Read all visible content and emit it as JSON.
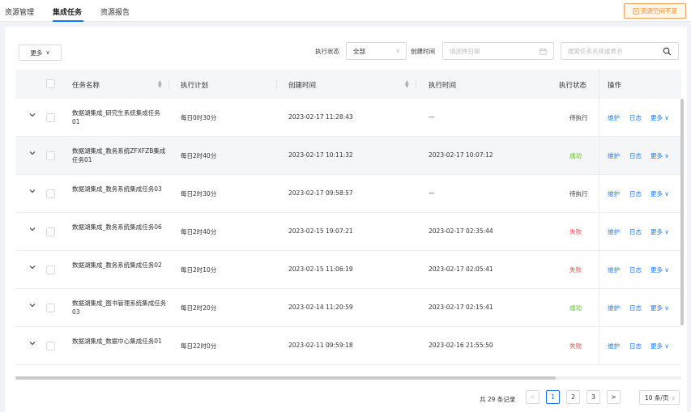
{
  "tabs": [
    {
      "label": "资源管理",
      "active": false
    },
    {
      "label": "集成任务",
      "active": true
    },
    {
      "label": "资源报告",
      "active": false
    }
  ],
  "warning_button": {
    "label": "资源空间不足",
    "icon": "edit-icon"
  },
  "toolbar": {
    "more_label": "更多",
    "status_label": "执行状态",
    "status_value": "全部",
    "created_label": "创建时间",
    "date_placeholder": "请选择日期",
    "search_placeholder": "搜索任务名称或表名"
  },
  "table": {
    "headers": {
      "name": "任务名称",
      "plan": "执行计划",
      "created": "创建时间",
      "exec_time": "执行时间",
      "status": "执行状态",
      "ops": "操作"
    },
    "op_labels": {
      "maintain": "维护",
      "log": "日志",
      "more": "更多"
    },
    "rows": [
      {
        "name": "数据湖集成_研究生系统集成任务01",
        "plan": "每日0时30分",
        "created": "2023-02-17 11:28:43",
        "exec_time": "—",
        "status": "待执行",
        "status_type": "wait"
      },
      {
        "name": "数据湖集成_教务系统ZFXFZB集成任务01",
        "plan": "每日2时40分",
        "created": "2023-02-17 10:11:32",
        "exec_time": "2023-02-17 10:07:12",
        "status": "成功",
        "status_type": "ok"
      },
      {
        "name": "数据湖集成_教务系统集成任务03",
        "plan": "每日2时30分",
        "created": "2023-02-17 09:58:57",
        "exec_time": "—",
        "status": "待执行",
        "status_type": "wait"
      },
      {
        "name": "数据湖集成_教务系统集成任务06",
        "plan": "每日2时40分",
        "created": "2023-02-15 19:07:21",
        "exec_time": "2023-02-17 02:35:44",
        "status": "失败",
        "status_type": "fail"
      },
      {
        "name": "数据湖集成_教务系统集成任务02",
        "plan": "每日2时10分",
        "created": "2023-02-15 11:06:19",
        "exec_time": "2023-02-17 02:05:41",
        "status": "失败",
        "status_type": "fail"
      },
      {
        "name": "数据湖集成_图书管理系统集成任务03",
        "plan": "每日2时20分",
        "created": "2023-02-14 11:20:59",
        "exec_time": "2023-02-17 02:15:41",
        "status": "成功",
        "status_type": "ok"
      },
      {
        "name": "数据湖集成_数据中心集成任务01",
        "plan": "每日22时0分",
        "created": "2023-02-11 09:59:18",
        "exec_time": "2023-02-16 21:55:50",
        "status": "失败",
        "status_type": "fail"
      }
    ]
  },
  "pagination": {
    "total_text": "共 29 条记录",
    "pages": [
      "1",
      "2",
      "3"
    ],
    "current": "1",
    "page_size": "10 条/页"
  },
  "colors": {
    "primary": "#1677ff",
    "success": "#52c41a",
    "danger": "#ff4d4f",
    "warning": "#f08c2e"
  }
}
